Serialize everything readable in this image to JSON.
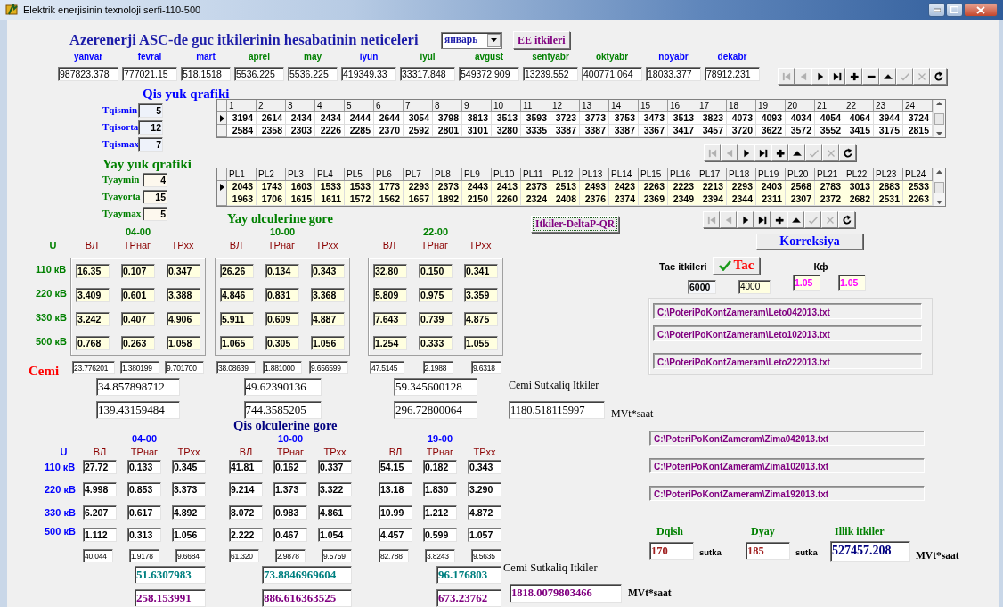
{
  "window": {
    "title": "Elektrik enerjisinin texnoloji serfi-110-500"
  },
  "header": {
    "title": "Azerenerji ASC-de guc itkilerinin hesabatinin neticeleri",
    "month_select": "январь",
    "ee_button": "EE itkileri"
  },
  "months": [
    {
      "label": "yanvar",
      "value": "987823.378",
      "color": "#0000ff"
    },
    {
      "label": "fevral",
      "value": "777021.15",
      "color": "#0000ff"
    },
    {
      "label": "mart",
      "value": "518.1518",
      "color": "#0000ff"
    },
    {
      "label": "aprel",
      "value": "5536.225",
      "color": "#008000"
    },
    {
      "label": "may",
      "value": "5536.225",
      "color": "#008000"
    },
    {
      "label": "iyun",
      "value": "419349.33",
      "color": "#0000ff"
    },
    {
      "label": "iyul",
      "value": "33317.848",
      "color": "#008000"
    },
    {
      "label": "avgust",
      "value": "549372.909",
      "color": "#008000"
    },
    {
      "label": "sentyabr",
      "value": "13239.552",
      "color": "#008000"
    },
    {
      "label": "oktyabr",
      "value": "400771.064",
      "color": "#008000"
    },
    {
      "label": "noyabr",
      "value": "18033.377",
      "color": "#0000ff"
    },
    {
      "label": "dekabr",
      "value": "78912.231",
      "color": "#0000ff"
    }
  ],
  "navigators": [
    {
      "buttons": [
        {
          "kind": "first",
          "disabled": true
        },
        {
          "kind": "prior",
          "disabled": true
        },
        {
          "kind": "next",
          "disabled": false
        },
        {
          "kind": "last",
          "disabled": false
        },
        {
          "kind": "insert",
          "disabled": false
        },
        {
          "kind": "delete",
          "disabled": false
        },
        {
          "kind": "edit",
          "disabled": false
        },
        {
          "kind": "post",
          "disabled": true
        },
        {
          "kind": "cancel",
          "disabled": true
        },
        {
          "kind": "refresh",
          "disabled": false
        }
      ]
    },
    {
      "buttons": [
        {
          "kind": "first",
          "disabled": true
        },
        {
          "kind": "prior",
          "disabled": true
        },
        {
          "kind": "next",
          "disabled": false
        },
        {
          "kind": "last",
          "disabled": false
        },
        {
          "kind": "insert",
          "disabled": false
        },
        {
          "kind": "edit",
          "disabled": false
        },
        {
          "kind": "post",
          "disabled": true
        },
        {
          "kind": "cancel",
          "disabled": true
        },
        {
          "kind": "refresh",
          "disabled": false
        }
      ]
    },
    {
      "buttons": [
        {
          "kind": "first",
          "disabled": true
        },
        {
          "kind": "prior",
          "disabled": true
        },
        {
          "kind": "next",
          "disabled": false
        },
        {
          "kind": "last",
          "disabled": false
        },
        {
          "kind": "insert",
          "disabled": false
        },
        {
          "kind": "edit",
          "disabled": false
        },
        {
          "kind": "post",
          "disabled": true
        },
        {
          "kind": "cancel",
          "disabled": true
        },
        {
          "kind": "refresh",
          "disabled": false
        }
      ]
    }
  ],
  "winter_load": {
    "title": "Qis yuk qrafiki",
    "params": [
      {
        "label": "Tqismin",
        "value": "5"
      },
      {
        "label": "Tqisorta",
        "value": "12"
      },
      {
        "label": "Tqismax",
        "value": "7"
      }
    ],
    "grid": {
      "columns": [
        "1",
        "2",
        "3",
        "4",
        "5",
        "6",
        "7",
        "8",
        "9",
        "10",
        "11",
        "12",
        "13",
        "14",
        "15",
        "16",
        "17",
        "18",
        "19",
        "20",
        "21",
        "22",
        "23",
        "24"
      ],
      "rows": [
        {
          "selected": true,
          "cells": [
            "3194",
            "2614",
            "2434",
            "2434",
            "2444",
            "2644",
            "3054",
            "3798",
            "3813",
            "3513",
            "3593",
            "3723",
            "3773",
            "3753",
            "3473",
            "3513",
            "3823",
            "4073",
            "4093",
            "4034",
            "4054",
            "4064",
            "3944",
            "3724"
          ]
        },
        {
          "selected": false,
          "cells": [
            "2584",
            "2358",
            "2303",
            "2226",
            "2285",
            "2370",
            "2592",
            "2801",
            "3101",
            "3280",
            "3335",
            "3387",
            "3387",
            "3387",
            "3367",
            "3417",
            "3457",
            "3720",
            "3622",
            "3572",
            "3552",
            "3415",
            "3175",
            "2815"
          ]
        }
      ]
    }
  },
  "summer_load": {
    "title": "Yay yuk qrafiki",
    "params": [
      {
        "label": "Tyaymin",
        "value": "4"
      },
      {
        "label": "Tyayorta",
        "value": "15"
      },
      {
        "label": "Tyaymax",
        "value": "5"
      }
    ],
    "grid": {
      "columns": [
        "PL1",
        "PL2",
        "PL3",
        "PL4",
        "PL5",
        "PL6",
        "PL7",
        "PL8",
        "PL9",
        "PL10",
        "PL11",
        "PL12",
        "PL13",
        "PL14",
        "PL15",
        "PL16",
        "PL17",
        "PL18",
        "PL19",
        "PL20",
        "PL21",
        "PL22",
        "PL23",
        "PL24"
      ],
      "rows": [
        {
          "selected": true,
          "cells": [
            "2043",
            "1743",
            "1603",
            "1533",
            "1533",
            "1773",
            "2293",
            "2373",
            "2443",
            "2413",
            "2373",
            "2513",
            "2493",
            "2423",
            "2263",
            "2223",
            "2213",
            "2293",
            "2403",
            "2568",
            "2783",
            "3013",
            "2883",
            "2533"
          ]
        },
        {
          "selected": false,
          "cells": [
            "1963",
            "1706",
            "1615",
            "1611",
            "1572",
            "1562",
            "1657",
            "1892",
            "2150",
            "2260",
            "2324",
            "2408",
            "2376",
            "2374",
            "2369",
            "2349",
            "2394",
            "2344",
            "2311",
            "2307",
            "2372",
            "2682",
            "2531",
            "2263"
          ]
        }
      ]
    }
  },
  "summer_measure": {
    "title": "Yay olculerine gore",
    "u_label": "U",
    "voltages": [
      "110 кВ",
      "220 кВ",
      "330 кВ",
      "500 кВ"
    ],
    "cemi_label": "Cemi",
    "groups": [
      {
        "time": "04-00",
        "headers": [
          "ВЛ",
          "ТРнаг",
          "ТРхх"
        ],
        "rows": [
          [
            "16.35",
            "0.107",
            "0.347"
          ],
          [
            "3.409",
            "0.601",
            "3.388"
          ],
          [
            "3.242",
            "0.407",
            "4.906"
          ],
          [
            "0.768",
            "0.263",
            "1.058"
          ]
        ],
        "totals": [
          "23.776201",
          "1.380199",
          "9.701700"
        ],
        "sum": "34.857898712",
        "energy": "139.43159484"
      },
      {
        "time": "10-00",
        "headers": [
          "ВЛ",
          "ТРнаг",
          "ТРхх"
        ],
        "rows": [
          [
            "26.26",
            "0.134",
            "0.343"
          ],
          [
            "4.846",
            "0.831",
            "3.368"
          ],
          [
            "5.911",
            "0.609",
            "4.887"
          ],
          [
            "1.065",
            "0.305",
            "1.056"
          ]
        ],
        "totals": [
          "38.08639",
          "1.881000",
          "9.656599"
        ],
        "sum": "49.62390136",
        "energy": "744.3585205"
      },
      {
        "time": "22-00",
        "headers": [
          "ВЛ",
          "ТРнаг",
          "ТРхх"
        ],
        "rows": [
          [
            "32.80",
            "0.150",
            "0.341"
          ],
          [
            "5.809",
            "0.975",
            "3.359"
          ],
          [
            "7.643",
            "0.739",
            "4.875"
          ],
          [
            "1.254",
            "0.333",
            "1.055"
          ]
        ],
        "totals": [
          "47.5145",
          "2.1988",
          "9.6318"
        ],
        "sum": "59.345600128",
        "energy": "296.72800064"
      }
    ]
  },
  "deltap_button": "Itkiler-DeltaP-QR",
  "correction_button": "Korreksiya",
  "tac": {
    "label": "Tac itkileri",
    "button": "Tac",
    "kf_label": "Кф",
    "values": [
      "6000",
      "4000"
    ],
    "kf_values": [
      "1.05",
      "1.05"
    ]
  },
  "summer_files": [
    "C:\\PoteriPoKontZameram\\Leto042013.txt",
    "C:\\PoteriPoKontZameram\\Leto102013.txt",
    "C:\\PoteriPoKontZameram\\Leto222013.txt"
  ],
  "summer_daily": {
    "label": "Cemi Sutkaliq Itkiler",
    "value": "1180.518115997",
    "unit": "MVt*saat"
  },
  "winter_measure": {
    "title": "Qis olculerine gore",
    "u_label": "U",
    "voltages": [
      "110 кВ",
      "220 кВ",
      "330 кВ",
      "500 кВ"
    ],
    "groups": [
      {
        "time": "04-00",
        "headers": [
          "ВЛ",
          "ТРнаг",
          "ТРхх"
        ],
        "rows": [
          [
            "27.72",
            "0.133",
            "0.345"
          ],
          [
            "4.998",
            "0.853",
            "3.373"
          ],
          [
            "6.207",
            "0.617",
            "4.892"
          ],
          [
            "1.112",
            "0.313",
            "1.056"
          ]
        ],
        "totals": [
          "40.044",
          "1.9178",
          "9.6684"
        ],
        "sum": "51.6307983",
        "energy": "258.153991"
      },
      {
        "time": "10-00",
        "headers": [
          "ВЛ",
          "ТРнаг",
          "ТРхх"
        ],
        "rows": [
          [
            "41.81",
            "0.162",
            "0.337"
          ],
          [
            "9.214",
            "1.373",
            "3.322"
          ],
          [
            "8.072",
            "0.983",
            "4.861"
          ],
          [
            "2.222",
            "0.467",
            "1.054"
          ]
        ],
        "totals": [
          "61.320",
          "2.9878",
          "9.5759"
        ],
        "sum": "73.8846969604",
        "energy": "886.616363525"
      },
      {
        "time": "19-00",
        "headers": [
          "ВЛ",
          "ТРнаг",
          "ТРхх"
        ],
        "rows": [
          [
            "54.15",
            "0.182",
            "0.343"
          ],
          [
            "13.18",
            "1.830",
            "3.290"
          ],
          [
            "10.99",
            "1.212",
            "4.872"
          ],
          [
            "4.457",
            "0.599",
            "1.057"
          ]
        ],
        "totals": [
          "82.788",
          "3.8243",
          "9.5635"
        ],
        "sum": "96.176803",
        "energy": "673.23762"
      }
    ]
  },
  "winter_files": [
    "C:\\PoteriPoKontZameram\\Zima042013.txt",
    "C:\\PoteriPoKontZameram\\Zima102013.txt",
    "C:\\PoteriPoKontZameram\\Zima192013.txt"
  ],
  "annual": {
    "dqish_label": "Dqish",
    "dqish": "170",
    "dqish_unit": "sutka",
    "dyay_label": "Dyay",
    "dyay": "185",
    "dyay_unit": "sutka",
    "total_label": "Illik itkiler",
    "total": "527457.208",
    "unit": "MVt*saat"
  },
  "winter_daily": {
    "label": "Cemi Sutkaliq Itkiler",
    "value": "1818.0079803466",
    "unit": "MVt*saat"
  }
}
